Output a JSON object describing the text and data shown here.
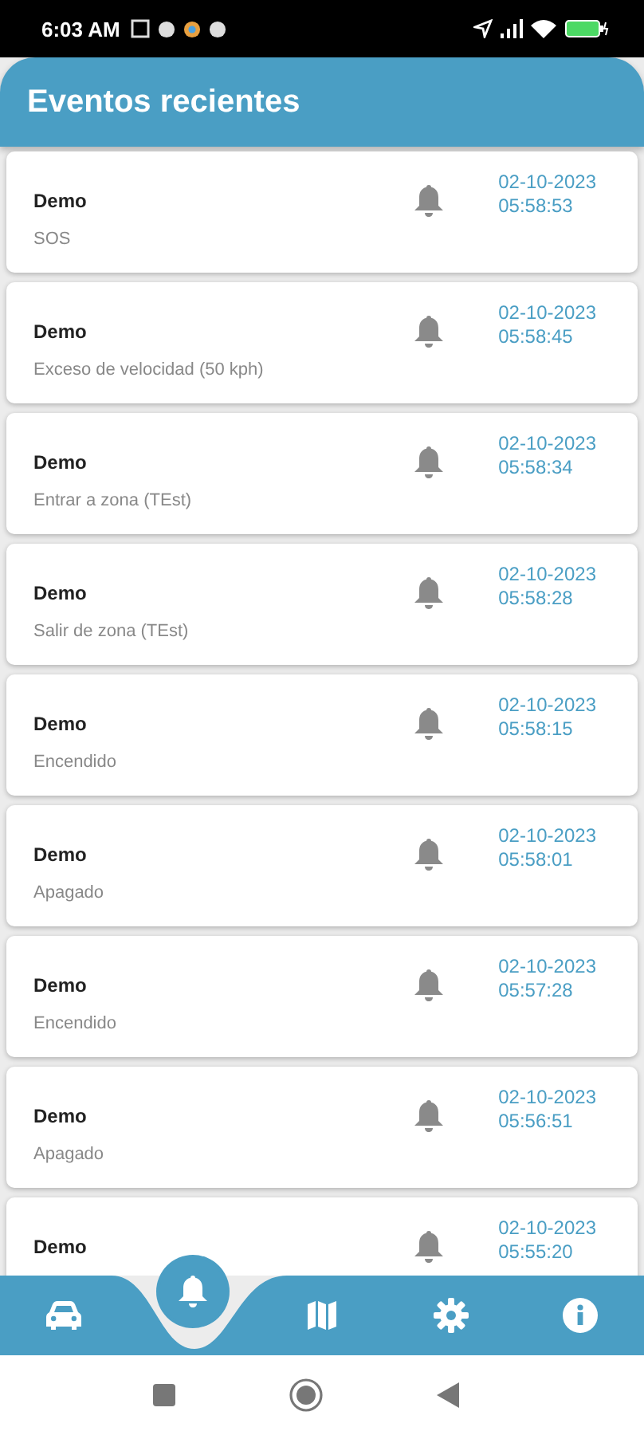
{
  "status_bar": {
    "time": "6:03 AM"
  },
  "header": {
    "title": "Eventos recientes"
  },
  "events": [
    {
      "device": "Demo",
      "description": "SOS",
      "date": "02-10-2023",
      "time": "05:58:53"
    },
    {
      "device": "Demo",
      "description": "Exceso de velocidad (50 kph)",
      "date": "02-10-2023",
      "time": "05:58:45"
    },
    {
      "device": "Demo",
      "description": "Entrar a zona (TEst)",
      "date": "02-10-2023",
      "time": "05:58:34"
    },
    {
      "device": "Demo",
      "description": "Salir de zona (TEst)",
      "date": "02-10-2023",
      "time": "05:58:28"
    },
    {
      "device": "Demo",
      "description": "Encendido",
      "date": "02-10-2023",
      "time": "05:58:15"
    },
    {
      "device": "Demo",
      "description": "Apagado",
      "date": "02-10-2023",
      "time": "05:58:01"
    },
    {
      "device": "Demo",
      "description": "Encendido",
      "date": "02-10-2023",
      "time": "05:57:28"
    },
    {
      "device": "Demo",
      "description": "Apagado",
      "date": "02-10-2023",
      "time": "05:56:51"
    },
    {
      "device": "Demo",
      "date": "02-10-2023",
      "time": "05:55:20"
    }
  ],
  "bottom_nav": [
    {
      "kind": "car",
      "selected": false
    },
    {
      "kind": "bell",
      "selected": true
    },
    {
      "kind": "map",
      "selected": false
    },
    {
      "kind": "settings",
      "selected": false
    },
    {
      "kind": "info",
      "selected": false
    }
  ]
}
